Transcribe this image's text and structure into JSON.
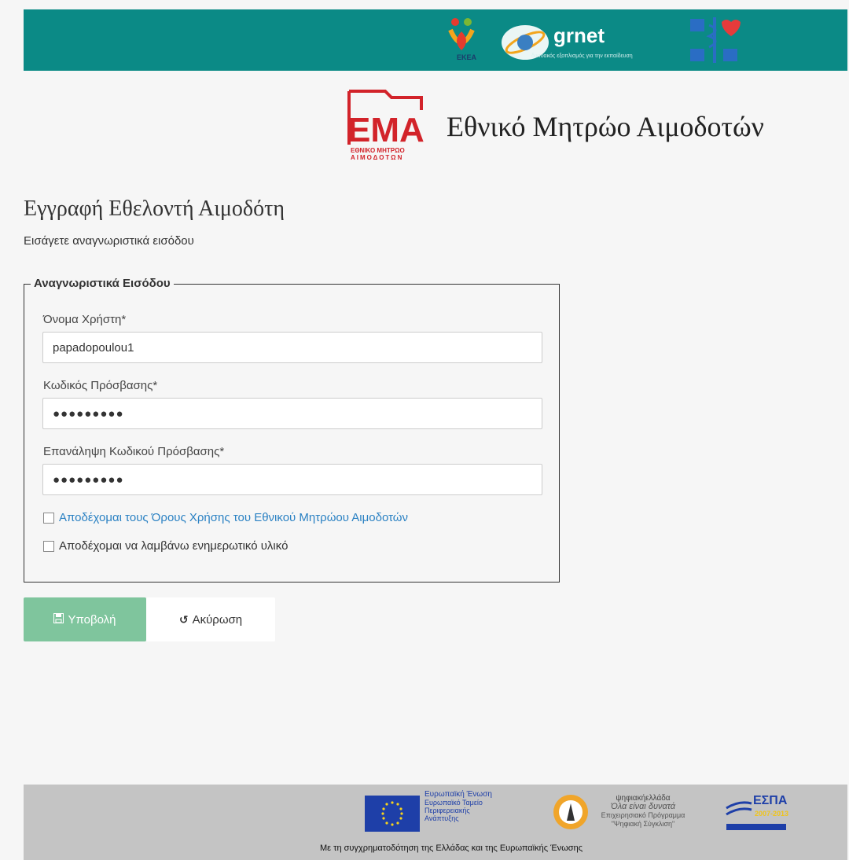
{
  "topbar": {
    "ekea_label": "ΕΚΕΑ",
    "grnet_label": "grnet",
    "grnet_tagline": "δικτυακός εξοπλισμός για την εκπαίδευση"
  },
  "brand": {
    "logo_text": "ΕΜΑ",
    "logo_sub": "ΕΘΝΙΚΟ ΜΗΤΡΩΟ ΑΙΜΟΔΟΤΩΝ",
    "title": "Εθνικό Μητρώο Αιμοδοτών"
  },
  "page": {
    "title": "Εγγραφή Εθελοντή Αιμοδότη",
    "subtitle": "Εισάγετε αναγνωριστικά εισόδου"
  },
  "form": {
    "legend": "Αναγνωριστικά Εισόδου",
    "username_label": "Όνομα Χρήστη*",
    "username_value": "papadopoulou1",
    "password_label": "Κωδικός Πρόσβασης*",
    "password_value": "●●●●●●●●●",
    "password_repeat_label": "Επανάληψη Κωδικού Πρόσβασης*",
    "password_repeat_value": "●●●●●●●●●",
    "terms_label": "Αποδέχομαι τους Όρους Χρήσης του Εθνικού Μητρώου Αιμοδοτών",
    "newsletter_label": "Αποδέχομαι να λαμβάνω ενημερωτικό υλικό"
  },
  "actions": {
    "submit_label": "Υποβολή",
    "cancel_label": "Ακύρωση"
  },
  "footer": {
    "eu_title": "Ευρωπαϊκή Ένωση",
    "eu_line1": "Ευρωπαϊκό Ταμείο",
    "eu_line2": "Περιφερειακής",
    "eu_line3": "Ανάπτυξης",
    "digital_title": "ψηφιακήελλάδα",
    "digital_line1": "Όλα είναι δυνατά",
    "digital_line2": "Επιχειρησιακό Πρόγραμμα",
    "digital_line3": "\"Ψηφιακή Σύγκλιση\"",
    "espa_label": "ΕΣΠΑ",
    "espa_years": "2007-2013",
    "cofunding": "Με τη συγχρηματοδότηση της Ελλάδας και της Ευρωπαϊκής Ένωσης"
  }
}
